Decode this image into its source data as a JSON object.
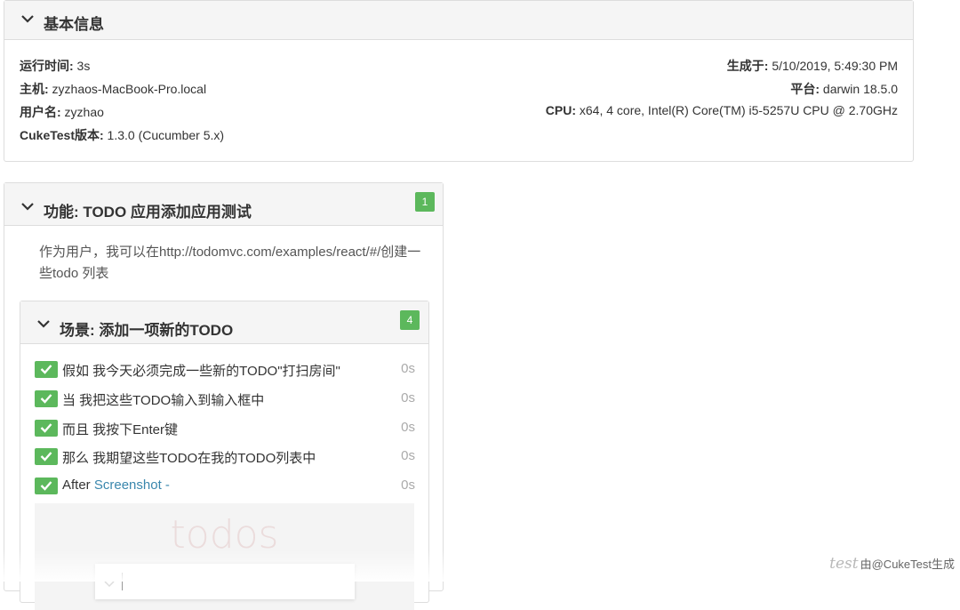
{
  "basic_info": {
    "title": "基本信息",
    "left": [
      {
        "label": "运行时间:",
        "value": " 3s"
      },
      {
        "label": "主机:",
        "value": " zyzhaos-MacBook-Pro.local"
      },
      {
        "label": "用户名:",
        "value": " zyzhao"
      },
      {
        "label": "CukeTest版本:",
        "value": " 1.3.0 (Cucumber 5.x)"
      }
    ],
    "right": [
      {
        "label": "生成于:",
        "value": " 5/10/2019, 5:49:30 PM"
      },
      {
        "label": "平台:",
        "value": " darwin 18.5.0"
      },
      {
        "label": "CPU:",
        "value": " x64, 4 core, Intel(R) Core(TM) i5-5257U CPU @ 2.70GHz"
      }
    ]
  },
  "feature": {
    "title": "功能:  TODO 应用添加应用测试",
    "count": "1",
    "description": "作为用户，我可以在http://todomvc.com/examples/react/#/创建一些todo 列表"
  },
  "scenario": {
    "title": "场景:  添加一项新的TODO",
    "count": "4",
    "steps": [
      {
        "text": "假如 我今天必须完成一些新的TODO\"打扫房间\"",
        "duration": "0s"
      },
      {
        "text": "当 我把这些TODO输入到输入框中",
        "duration": "0s"
      },
      {
        "text": "而且 我按下Enter键",
        "duration": "0s"
      },
      {
        "text": "那么 我期望这些TODO在我的TODO列表中",
        "duration": "0s"
      },
      {
        "text": "After ",
        "link": "Screenshot -",
        "duration": "0s"
      }
    ],
    "screenshot_title": "todos"
  },
  "watermark": {
    "script": "test",
    "text": "由@CukeTest生成"
  },
  "colors": {
    "success": "#5cb85c",
    "link": "#3a87ad",
    "heading_bg": "#f5f5f5"
  }
}
